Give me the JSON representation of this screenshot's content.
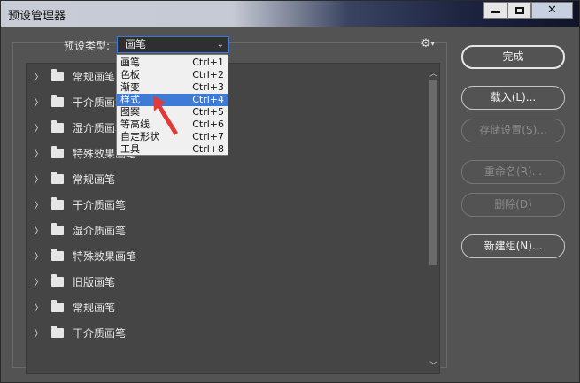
{
  "window": {
    "title": "预设管理器",
    "close_glyph": "✕"
  },
  "preset_type": {
    "label": "预设类型:",
    "value": "画笔"
  },
  "list_items": [
    "常规画笔",
    "干介质画笔",
    "湿介质画笔",
    "特殊效果画笔",
    "常规画笔",
    "干介质画笔",
    "湿介质画笔",
    "特殊效果画笔",
    "旧版画笔",
    "常规画笔",
    "干介质画笔"
  ],
  "dropdown": {
    "options": [
      {
        "label": "画笔",
        "shortcut": "Ctrl+1"
      },
      {
        "label": "色板",
        "shortcut": "Ctrl+2"
      },
      {
        "label": "渐变",
        "shortcut": "Ctrl+3"
      },
      {
        "label": "样式",
        "shortcut": "Ctrl+4"
      },
      {
        "label": "图案",
        "shortcut": "Ctrl+5"
      },
      {
        "label": "等高线",
        "shortcut": "Ctrl+6"
      },
      {
        "label": "自定形状",
        "shortcut": "Ctrl+7"
      },
      {
        "label": "工具",
        "shortcut": "Ctrl+8"
      }
    ],
    "selected_option": "样式"
  },
  "buttons": {
    "done": "完成",
    "load": "载入(L)...",
    "save_set": "存储设置(S)...",
    "rename": "重命名(R)...",
    "delete": "删除(D)",
    "new_group": "新建组(N)..."
  },
  "colors": {
    "dialog_bg": "#535353",
    "highlight": "#3d7bd6",
    "annotation_arrow": "#e23a36"
  }
}
